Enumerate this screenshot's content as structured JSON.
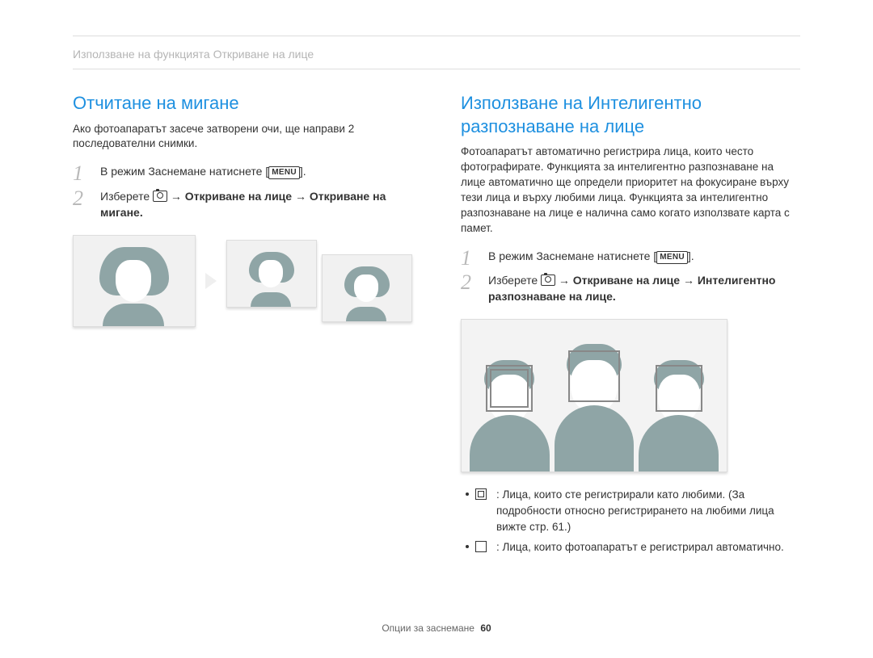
{
  "breadcrumb": "Използване на функцията Откриване на лице",
  "left": {
    "heading": "Отчитане на мигане",
    "intro": "Ако фотоапаратът засече затворени очи, ще направи 2 последователни снимки.",
    "step1_pre": "В режим Заснемане натиснете [",
    "step1_menu": "MENU",
    "step1_post": "].",
    "step2_pre": "Изберете ",
    "step2_arrow1": " → ",
    "step2_b1": "Откриване на лице",
    "step2_arrow2": " → ",
    "step2_b2": "Откриване на мигане",
    "step2_post": "."
  },
  "right": {
    "heading": "Използване на Интелигентно разпознаване на лице",
    "intro": "Фотоапаратът автоматично регистрира лица, които често фотографирате. Функцията за интелигентно разпознаване на лице автоматично ще определи приоритет на фокусиране върху тези лица и върху любими лица. Функцията за интелигентно разпознаване на лице е налична само когато използвате карта с памет.",
    "step1_pre": "В режим Заснемане натиснете [",
    "step1_menu": "MENU",
    "step1_post": "].",
    "step2_pre": "Изберете ",
    "step2_arrow1": " → ",
    "step2_b1": "Откриване на лице",
    "step2_arrow2": " → ",
    "step2_b2": "Интелигентно разпознаване на лице",
    "step2_post": ".",
    "bullet1": ": Лица, които сте регистрирали като любими. (За подробности относно регистрирането на любими лица вижте стр. 61.)",
    "bullet2": ": Лица, които фотоапаратът е регистрирал автоматично."
  },
  "footer": {
    "label": "Опции за заснемане",
    "page": "60"
  }
}
